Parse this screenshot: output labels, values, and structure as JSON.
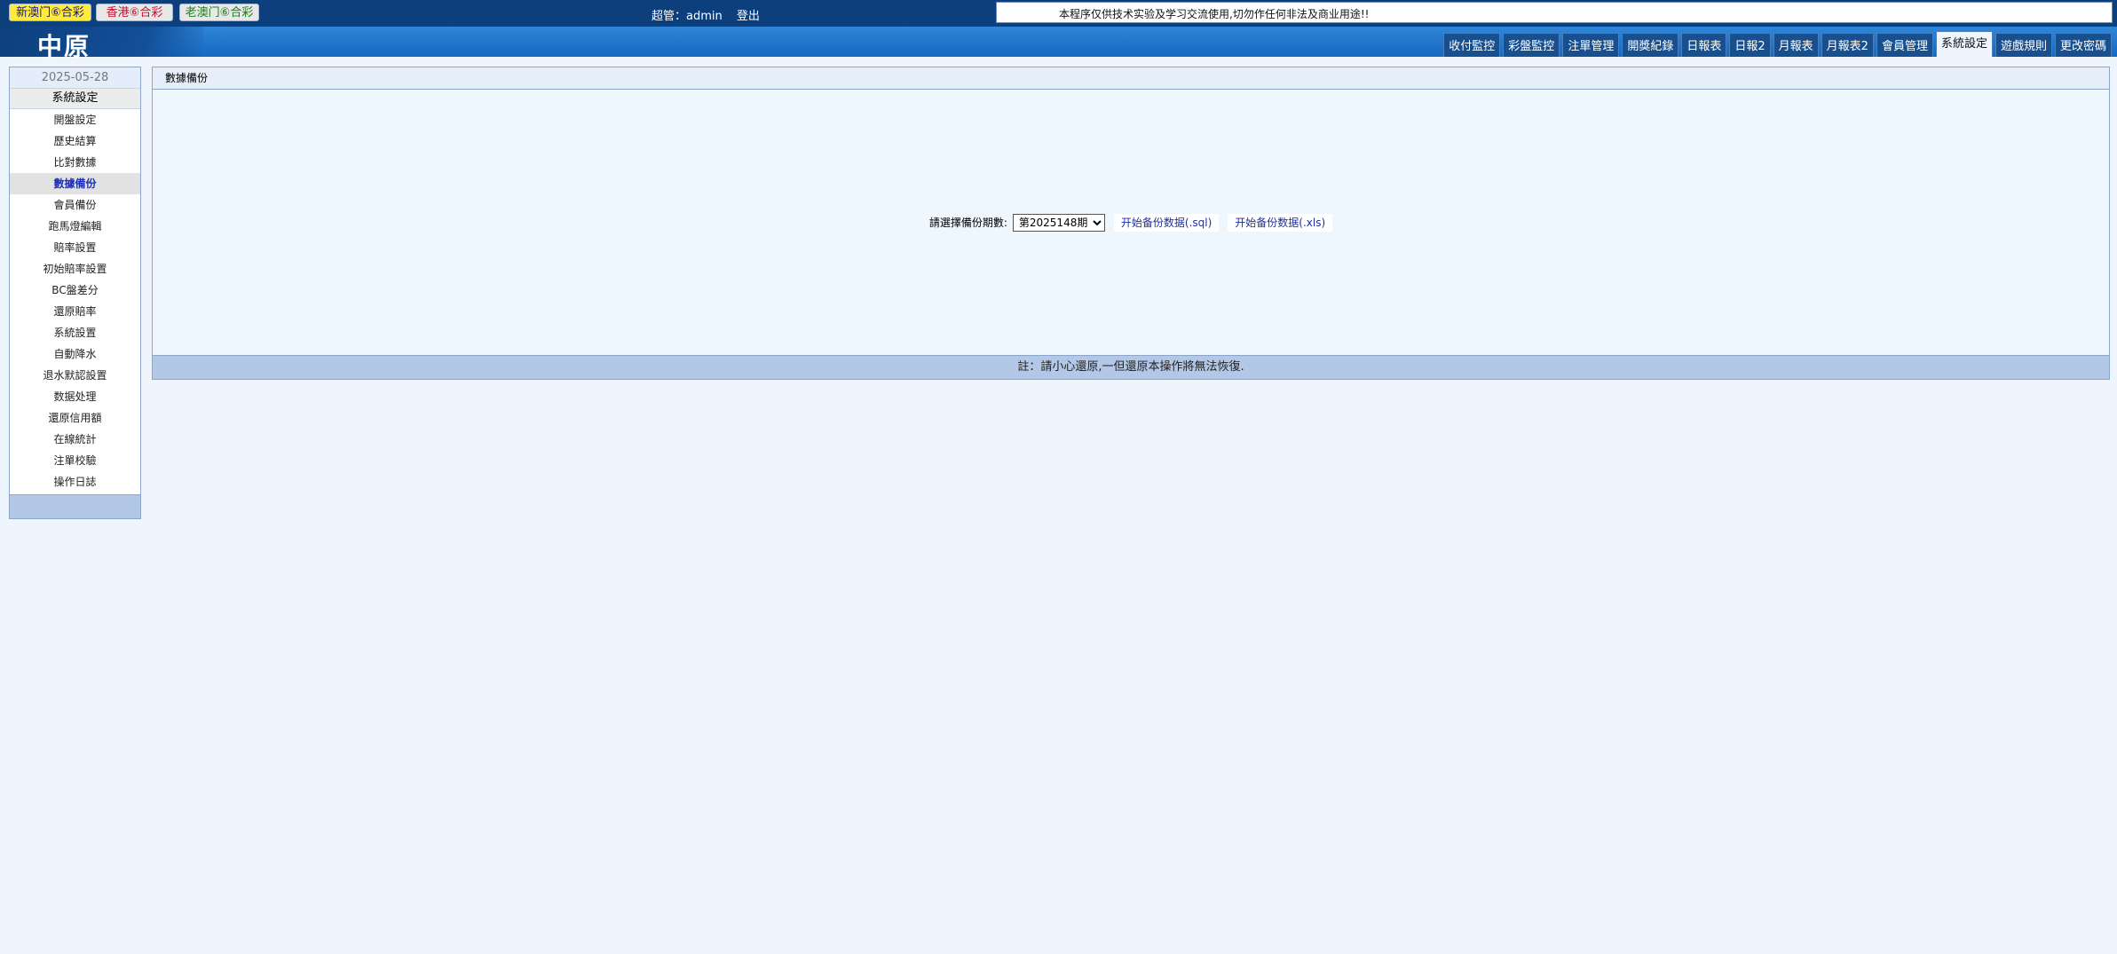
{
  "topbar": {
    "lotteries": [
      "新澳门⑥合彩",
      "香港⑥合彩",
      "老澳门⑥合彩"
    ],
    "user_label": "超管：admin",
    "logout_label": "登出",
    "notice": "本程序仅供技术实验及学习交流使用,切勿作任何非法及商业用途!!"
  },
  "header": {
    "logo": "中原",
    "tabs": [
      "收付監控",
      "彩盤監控",
      "注單管理",
      "開獎紀錄",
      "日報表",
      "日報2",
      "月報表",
      "月報表2",
      "會員管理",
      "系統設定",
      "遊戲規則",
      "更改密碼"
    ],
    "active_tab": "系統設定"
  },
  "sidebar": {
    "date": "2025-05-28",
    "title": "系統設定",
    "items": [
      "開盤設定",
      "歷史結算",
      "比對數據",
      "數據備份",
      "會員備份",
      "跑馬燈編輯",
      "賠率設置",
      "初始賠率設置",
      "BC盤差分",
      "還原賠率",
      "系統設置",
      "自動降水",
      "退水默認設置",
      "数据处理",
      "還原信用額",
      "在線統計",
      "注單校驗",
      "操作日誌"
    ],
    "active_item": "數據備份"
  },
  "main": {
    "title": "數據備份",
    "period_label": "請選擇備份期數:",
    "period_value": "第2025148期",
    "backup_sql_label": "开始备份数据(.sql)",
    "backup_xls_label": "开始备份数据(.xls)",
    "footer_note": "註：請小心還原,一但還原本操作將無法恢復."
  }
}
